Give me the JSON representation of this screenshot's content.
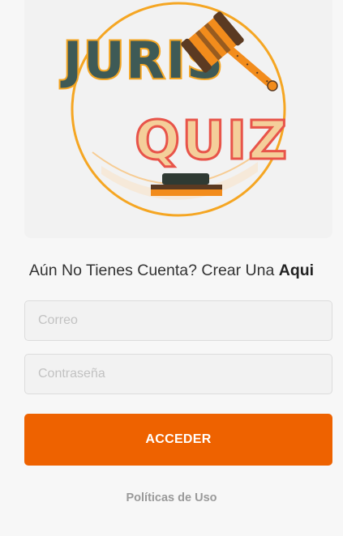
{
  "logo": {
    "line1": "JURIS",
    "line2": "QUIZ"
  },
  "signup": {
    "prompt": "Aún No Tienes Cuenta? Crear Una",
    "link": "Aqui"
  },
  "form": {
    "email_placeholder": "Correo",
    "email_value": "",
    "password_placeholder": "Contraseña",
    "password_value": ""
  },
  "submit_label": "ACCEDER",
  "footer_link": "Políticas de Uso",
  "colors": {
    "accent": "#ee6200",
    "logo_orange": "#f5a623",
    "logo_red": "#e8544a",
    "logo_dark": "#3e5a56",
    "gavel_wood": "#5b3a22",
    "gavel_orange": "#f28c1c"
  }
}
